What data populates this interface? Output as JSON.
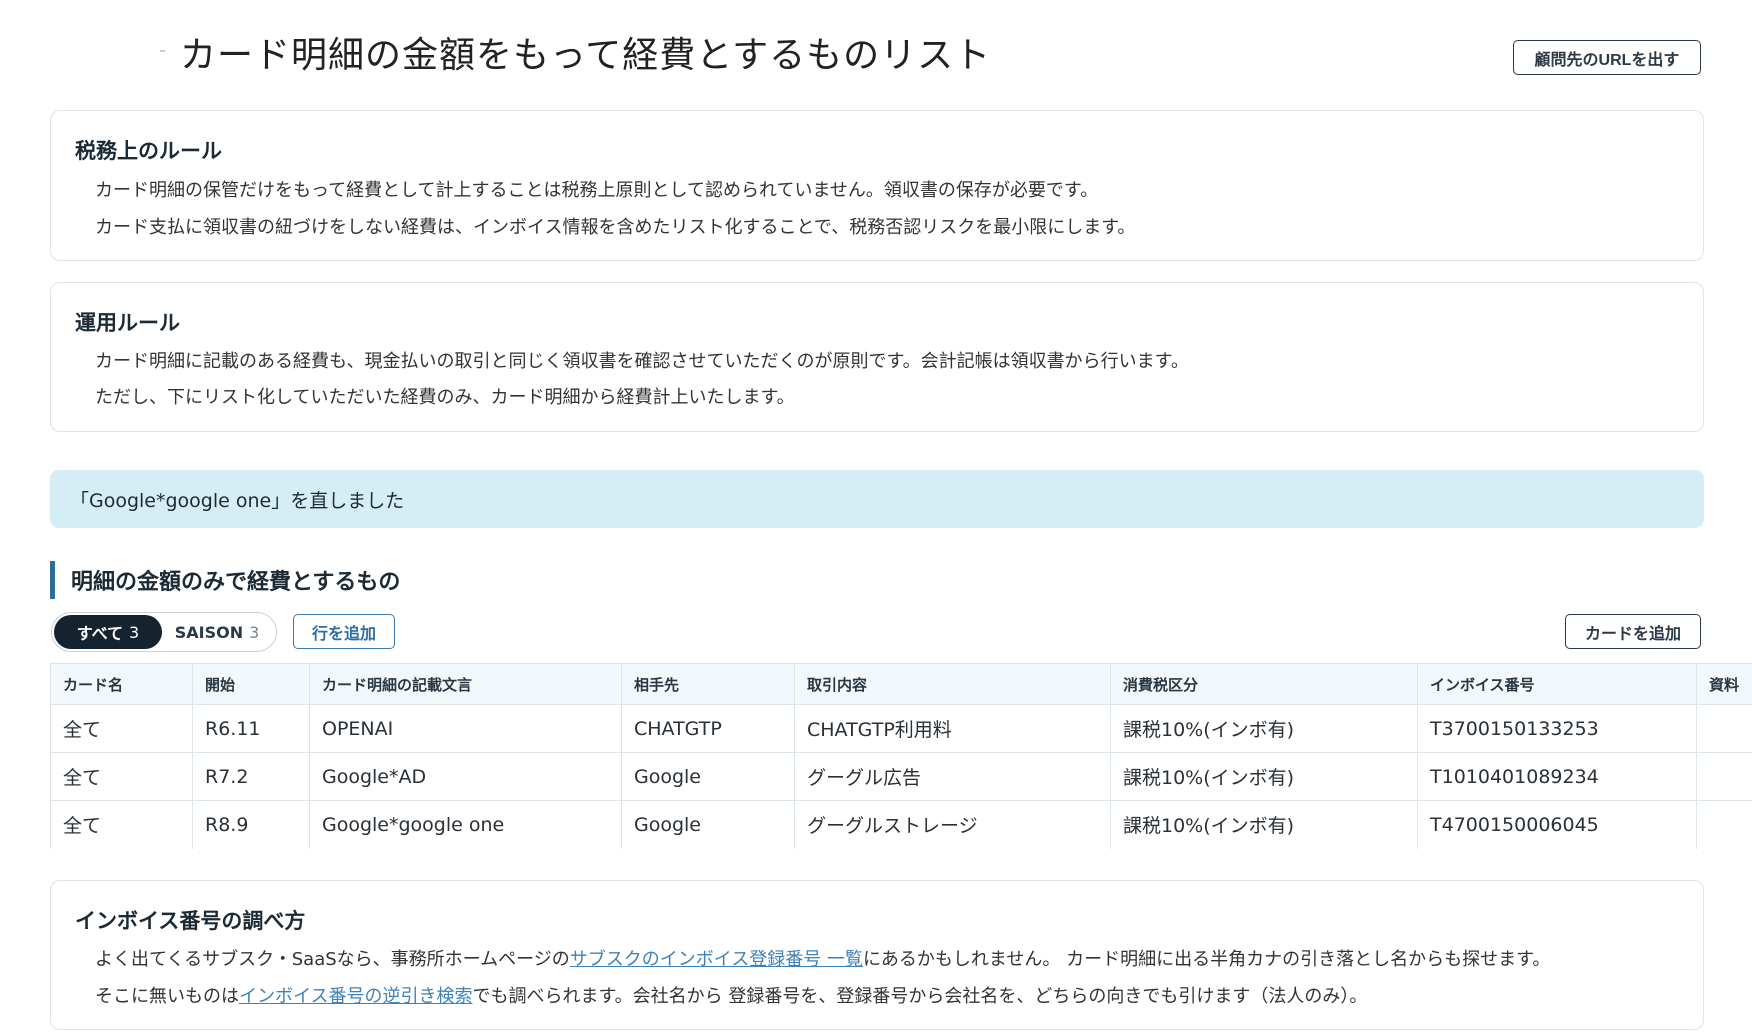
{
  "header": {
    "title": "カード明細の金額をもって経費とするものリスト",
    "advisor_url_button": "顧問先のURLを出す"
  },
  "tax_rules": {
    "heading": "税務上のルール",
    "line1": "カード明細の保管だけをもって経費として計上することは税務上原則として認められていません。領収書の保存が必要です。",
    "line2": "カード支払に領収書の紐づけをしない経費は、インボイス情報を含めたリスト化することで、税務否認リスクを最小限にします。"
  },
  "operation_rules": {
    "heading": "運用ルール",
    "line1": "カード明細に記載のある経費も、現金払いの取引と同じく領収書を確認させていただくのが原則です。会計記帳は領収書から行います。",
    "line2": "ただし、下にリスト化していただいた経費のみ、カード明細から経費計上いたします。"
  },
  "alert": {
    "message": "「Google*google one」を直しました"
  },
  "section": {
    "title": "明細の金額のみで経費とするもの"
  },
  "tabs": [
    {
      "label": "すべて",
      "count": "3"
    },
    {
      "label": "SAISON",
      "count": "3"
    }
  ],
  "toolbar": {
    "add_row_label": "行を追加",
    "add_card_label": "カードを追加"
  },
  "table": {
    "columns": [
      "カード名",
      "開始",
      "カード明細の記載文言",
      "相手先",
      "取引内容",
      "消費税区分",
      "インボイス番号",
      "資料"
    ],
    "rows": [
      [
        "全て",
        "R6.11",
        "OPENAI",
        "CHATGTP",
        "CHATGTP利用料",
        "課税10%(インボ有)",
        "T3700150133253",
        ""
      ],
      [
        "全て",
        "R7.2",
        "Google*AD",
        "Google",
        "グーグル広告",
        "課税10%(インボ有)",
        "T1010401089234",
        ""
      ],
      [
        "全て",
        "R8.9",
        "Google*google one",
        "Google",
        "グーグルストレージ",
        "課税10%(インボ有)",
        "T4700150006045",
        ""
      ]
    ]
  },
  "invoice_help": {
    "heading": "インボイス番号の調べ方",
    "line1_before": "よく出てくるサブスク・SaaSなら、事務所ホームページの",
    "line1_link": "サブスクのインボイス登録番号 一覧",
    "line1_after": "にあるかもしれません。 カード明細に出る半角カナの引き落とし名からも探せます。",
    "line2_before": "そこに無いものは",
    "line2_link": "インボイス番号の逆引き検索",
    "line2_after": "でも調べられます。会社名から 登録番号を、登録番号から会社名を、どちらの向きでも引けます（法人のみ）。"
  }
}
